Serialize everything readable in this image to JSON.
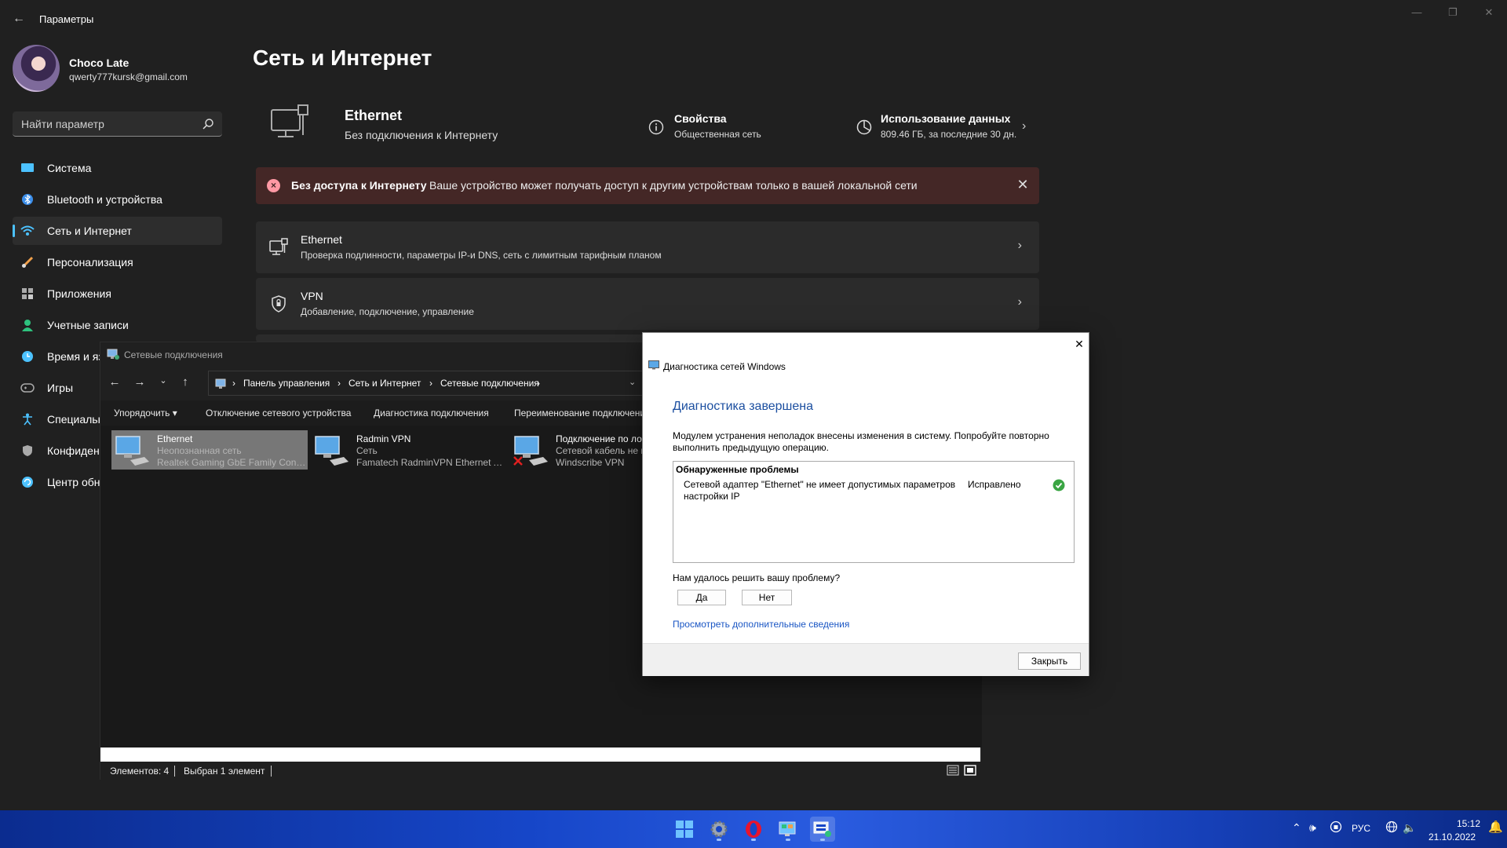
{
  "app": {
    "title": "Параметры"
  },
  "user": {
    "name": "Choco Late",
    "email": "qwerty777kursk@gmail.com"
  },
  "search": {
    "placeholder": "Найти параметр"
  },
  "sidebar": {
    "items": [
      {
        "label": "Система",
        "icon": "system-icon",
        "color": "#4cc2ff"
      },
      {
        "label": "Bluetooth и устройства",
        "icon": "bluetooth-icon",
        "color": "#3b8eea"
      },
      {
        "label": "Сеть и Интернет",
        "icon": "wifi-icon",
        "color": "#4cc2ff",
        "active": true
      },
      {
        "label": "Персонализация",
        "icon": "brush-icon",
        "color": "#f0a04b"
      },
      {
        "label": "Приложения",
        "icon": "apps-icon",
        "color": "#aaaaaa"
      },
      {
        "label": "Учетные записи",
        "icon": "person-icon",
        "color": "#2ec27e"
      },
      {
        "label": "Время и язык",
        "icon": "globe-clock-icon",
        "color": "#4cc2ff"
      },
      {
        "label": "Игры",
        "icon": "gamepad-icon",
        "color": "#aaaaaa"
      },
      {
        "label": "Специальные возможности",
        "icon": "accessibility-icon",
        "color": "#4cc2ff"
      },
      {
        "label": "Конфиденциальность и защита",
        "icon": "shield-icon",
        "color": "#aaaaaa"
      },
      {
        "label": "Центр обновления Windows",
        "icon": "update-icon",
        "color": "#4cc2ff"
      }
    ]
  },
  "page": {
    "title": "Сеть и Интернет"
  },
  "hero": {
    "name": "Ethernet",
    "status": "Без подключения к Интернету",
    "properties": {
      "title": "Свойства",
      "sub": "Общественная сеть"
    },
    "usage": {
      "title": "Использование данных",
      "sub": "809.46 ГБ, за последние 30 дн."
    }
  },
  "banner": {
    "title": "Без доступа к Интернету",
    "text": "Ваше устройство может получать доступ к другим устройствам только в вашей локальной сети"
  },
  "cards": [
    {
      "title": "Ethernet",
      "sub": "Проверка подлинности, параметры IP-и DNS, сеть с лимитным тарифным планом"
    },
    {
      "title": "VPN",
      "sub": "Добавление, подключение, управление"
    }
  ],
  "explorer": {
    "title": "Сетевые подключения",
    "breadcrumb": [
      "Панель управления",
      "Сеть и Интернет",
      "Сетевые подключения"
    ],
    "commands": [
      "Упорядочить",
      "Отключение сетевого устройства",
      "Диагностика подключения",
      "Переименование подключения"
    ],
    "items": [
      {
        "name": "Ethernet",
        "line2": "Неопознанная сеть",
        "line3": "Realtek Gaming GbE Family Contr...",
        "selected": true
      },
      {
        "name": "Radmin VPN",
        "line2": "Сеть",
        "line3": "Famatech RadminVPN Ethernet A..."
      },
      {
        "name": "Подключение по ло",
        "line2": "Сетевой кабель не п",
        "line3": "Windscribe VPN",
        "disconnected": true
      }
    ],
    "status": {
      "count": "Элементов: 4",
      "selected": "Выбран 1 элемент"
    }
  },
  "dialog": {
    "window_title": "Диагностика сетей Windows",
    "heading": "Диагностика завершена",
    "description": "Модулем устранения неполадок внесены изменения в систему. Попробуйте повторно выполнить предыдущую операцию.",
    "problems_header": "Обнаруженные проблемы",
    "problem_text": "Сетевой адаптер \"Ethernet\" не имеет допустимых параметров настройки IP",
    "problem_status": "Исправлено",
    "question": "Нам удалось решить вашу проблему?",
    "yes": "Да",
    "no": "Нет",
    "link": "Просмотреть дополнительные сведения",
    "close": "Закрыть"
  },
  "taskbar": {
    "lang": "РУС",
    "time": "15:12",
    "date": "21.10.2022",
    "apps": [
      "windows-start-icon",
      "settings-gear-icon",
      "opera-icon",
      "control-panel-icon",
      "network-connections-icon"
    ]
  },
  "colors": {
    "accent": "#4cc2ff",
    "error_banner": "#442726",
    "link": "#1a56c4",
    "taskbar": "#1646c8"
  }
}
